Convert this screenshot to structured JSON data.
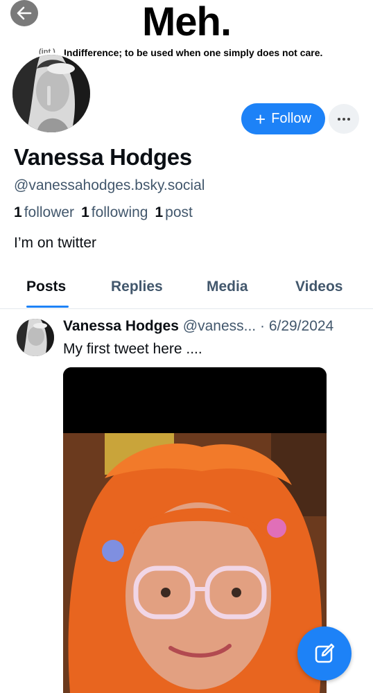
{
  "banner": {
    "title": "Meh.",
    "subtitle_prefix": "(int.)",
    "subtitle": "Indifference; to be used when one simply does not care."
  },
  "profile": {
    "display_name": "Vanessa Hodges",
    "handle": "@vanessahodges.bsky.social",
    "followers_count": "1",
    "followers_label": "follower",
    "following_count": "1",
    "following_label": "following",
    "posts_count": "1",
    "posts_label": "post",
    "bio": "I’m on twitter"
  },
  "actions": {
    "follow_label": "Follow",
    "more_icon": "ellipsis-icon",
    "back_icon": "arrow-left-icon",
    "compose_icon": "compose-icon"
  },
  "tabs": [
    {
      "label": "Posts",
      "active": true
    },
    {
      "label": "Replies",
      "active": false
    },
    {
      "label": "Media",
      "active": false
    },
    {
      "label": "Videos",
      "active": false
    }
  ],
  "post": {
    "author": "Vanessa Hodges",
    "handle": "@vaness...",
    "separator": "·",
    "date": "6/29/2024",
    "text": "My first tweet here ...."
  },
  "colors": {
    "accent": "#1d82f7",
    "secondary_text": "#42576c",
    "primary_text": "#0b0f14"
  }
}
